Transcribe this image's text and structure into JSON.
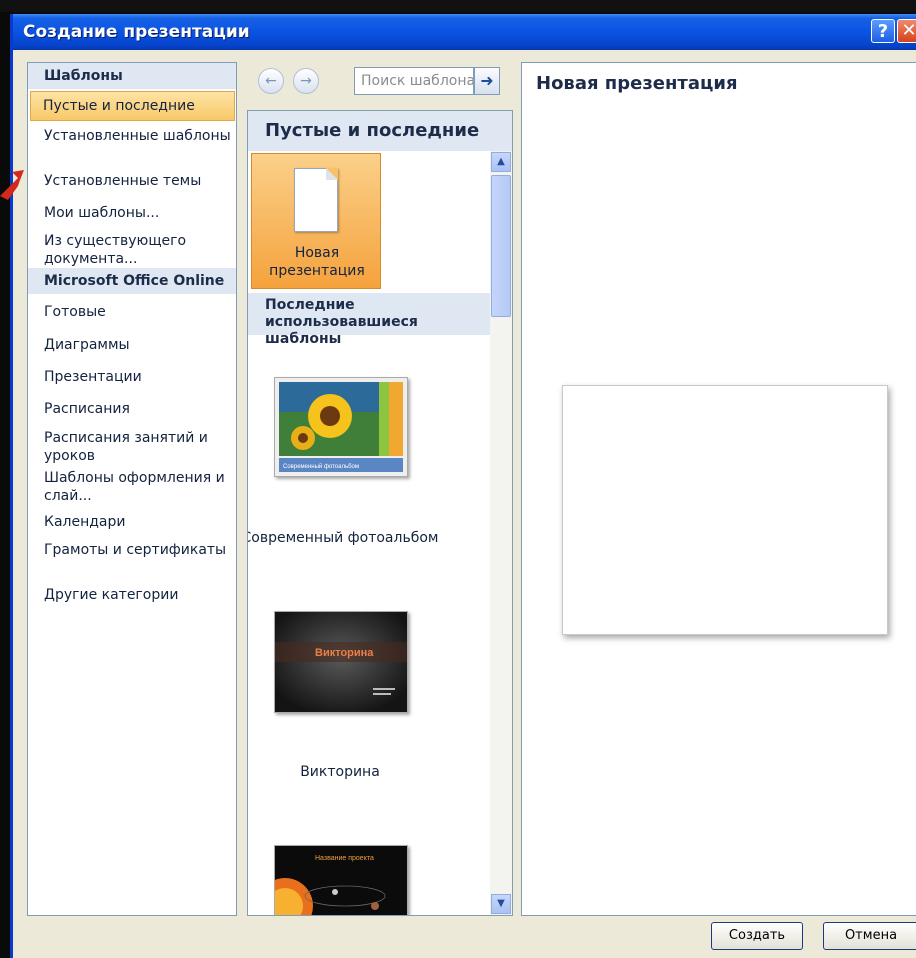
{
  "window": {
    "title": "Создание презентации",
    "help_label": "?",
    "close_label": "✕"
  },
  "left_nav": {
    "templates_header": "Шаблоны",
    "selected": "Пустые и последние",
    "items": [
      "Установленные шаблоны",
      "Установленные темы",
      "Мои шаблоны...",
      "Из существующего документа..."
    ],
    "online_header": "Microsoft Office Online",
    "online_items": [
      "Готовые",
      "Диаграммы",
      "Презентации",
      "Расписания",
      "Расписания занятий и уроков",
      "Шаблоны оформления и слай...",
      "Календари",
      "Грамоты и сертификаты",
      "Другие категории"
    ]
  },
  "search": {
    "placeholder": "Поиск шаблона"
  },
  "middle": {
    "header": "Пустые и последние",
    "new_tile_label": "Новая презентация",
    "recent_header": "Последние использовавшиеся шаблоны",
    "templates": [
      {
        "label": "Современный фотоальбом",
        "caption": "Современный фотоальбом"
      },
      {
        "label": "Викторина",
        "caption": "Викторина"
      },
      {
        "label": "",
        "caption": "Название проекта"
      }
    ]
  },
  "preview": {
    "title": "Новая презентация"
  },
  "buttons": {
    "create": "Создать",
    "cancel": "Отмена"
  },
  "colors": {
    "titlebar": "#0a54e3",
    "selected_bg": "#f8c968",
    "panel_header": "#dfe7f2"
  }
}
